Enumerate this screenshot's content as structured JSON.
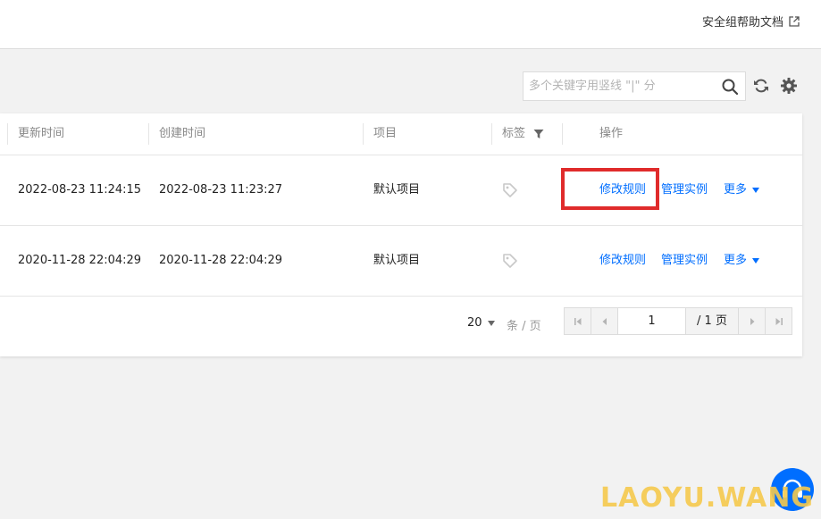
{
  "header": {
    "help_link": "安全组帮助文档"
  },
  "toolbar": {
    "search_placeholder": "多个关键字用竖线 \"|\" 分"
  },
  "table": {
    "columns": {
      "updated": "更新时间",
      "created": "创建时间",
      "project": "项目",
      "tags": "标签",
      "actions": "操作"
    },
    "rows": [
      {
        "updated": "2022-08-23 11:24:15",
        "created": "2022-08-23 11:23:27",
        "project": "默认项目",
        "edit": "修改规则",
        "manage": "管理实例",
        "more": "更多"
      },
      {
        "updated": "2020-11-28 22:04:29",
        "created": "2020-11-28 22:04:29",
        "project": "默认项目",
        "edit": "修改规则",
        "manage": "管理实例",
        "more": "更多"
      }
    ]
  },
  "pagination": {
    "page_size": "20",
    "per_page_label": "条 / 页",
    "current_page": "1",
    "total_pages": "/ 1 页"
  },
  "watermark": "LAOYU.WANG",
  "colors": {
    "accent": "#006eff",
    "highlight": "#e02b2b",
    "watermark": "#f6c94d"
  }
}
